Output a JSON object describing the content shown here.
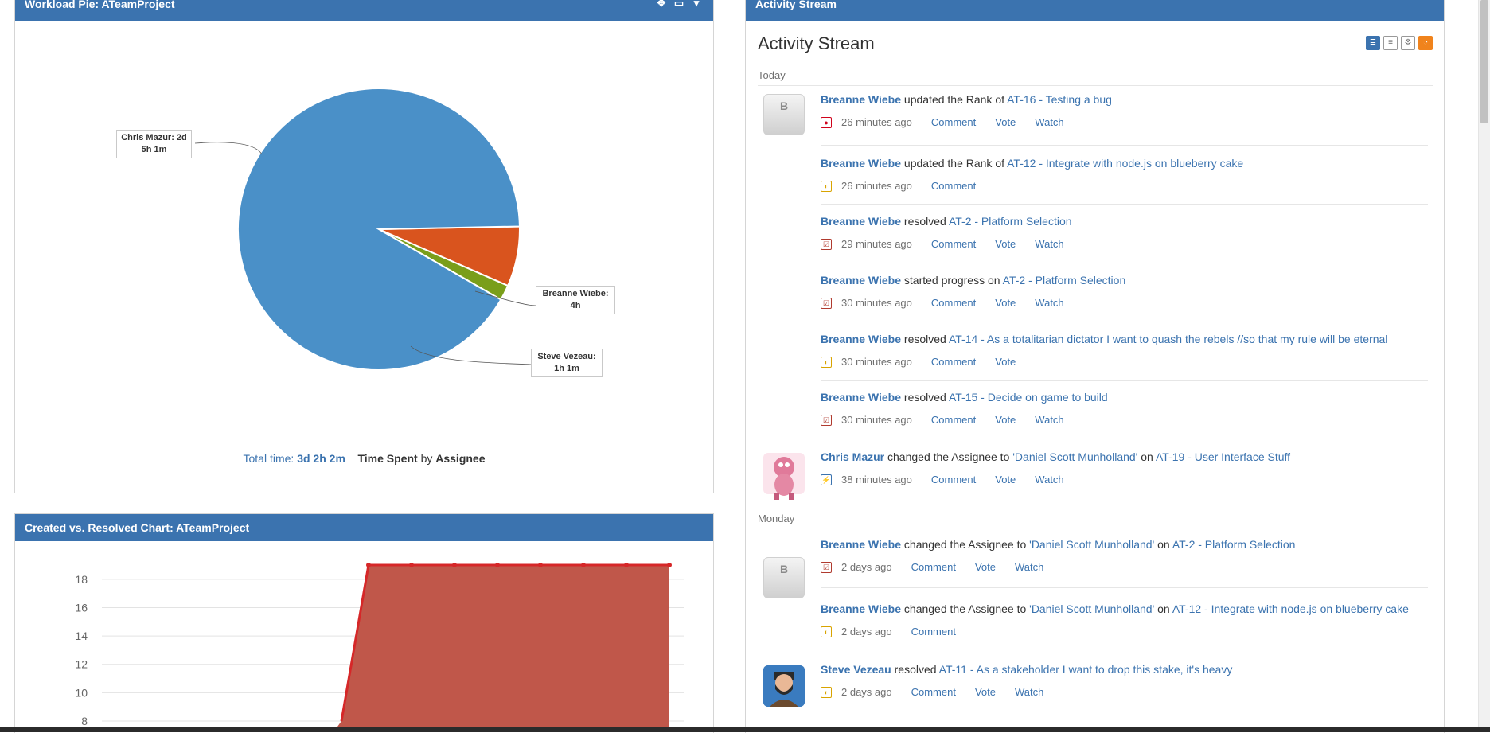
{
  "pie_gadget": {
    "title": "Workload Pie: ATeamProject",
    "tooltips": [
      {
        "text": "Chris Mazur: 2d 5h 1m",
        "line1": "Chris Mazur: 2d",
        "line2": "5h 1m"
      },
      {
        "text": "Breanne Wiebe: 4h",
        "line1": "Breanne Wiebe:",
        "line2": "4h"
      },
      {
        "text": "Steve Vezeau: 1h 1m",
        "line1": "Steve Vezeau:",
        "line2": "1h 1m"
      }
    ],
    "footer": {
      "total_label": "Total time:",
      "total_value": "3d 2h 2m",
      "field": "Time Spent",
      "by": "by",
      "group": "Assignee"
    }
  },
  "chart_data": [
    {
      "type": "pie",
      "labels": [
        "Chris Mazur",
        "Breanne Wiebe",
        "Steve Vezeau"
      ],
      "values": [
        53.0,
        4.0,
        1.0167
      ],
      "display_values": [
        "2d 5h 1m",
        "4h",
        "1h 1m"
      ],
      "colors": [
        "#4a90c8",
        "#d9541e",
        "#7a9e1a"
      ]
    },
    {
      "type": "area",
      "title": "Created vs. Resolved Chart: ATeamProject",
      "y_ticks": [
        8,
        10,
        12,
        14,
        16,
        18
      ],
      "series": [
        {
          "values": [
            8,
            19,
            19,
            19,
            19,
            19,
            19,
            19,
            19
          ]
        }
      ],
      "colors": {
        "line": "#d62728",
        "fill": "#c0574a"
      }
    }
  ],
  "created_gadget": {
    "title": "Created vs. Resolved Chart: ATeamProject"
  },
  "activity": {
    "gadget_title": "Activity Stream",
    "heading": "Activity Stream",
    "days": [
      "Today",
      "Monday"
    ],
    "items": [
      {
        "user": "Breanne Wiebe",
        "verb": " updated the Rank of ",
        "target": "AT-16 - Testing a bug",
        "time": "26 minutes ago",
        "actions": [
          "Comment",
          "Vote",
          "Watch"
        ]
      },
      {
        "user": "Breanne Wiebe",
        "verb": " updated the Rank of ",
        "target": "AT-12 - Integrate with node.js on blueberry cake",
        "time": "26 minutes ago",
        "actions": [
          "Comment"
        ]
      },
      {
        "user": "Breanne Wiebe",
        "verb": " resolved ",
        "target": "AT-2 - Platform Selection",
        "time": "29 minutes ago",
        "actions": [
          "Comment",
          "Vote",
          "Watch"
        ]
      },
      {
        "user": "Breanne Wiebe",
        "verb": " started progress on ",
        "target": "AT-2 - Platform Selection",
        "time": "30 minutes ago",
        "actions": [
          "Comment",
          "Vote",
          "Watch"
        ]
      },
      {
        "user": "Breanne Wiebe",
        "verb": " resolved ",
        "target": "AT-14 - As a totalitarian dictator I want to quash the rebels //so that my rule will be eternal",
        "time": "30 minutes ago",
        "actions": [
          "Comment",
          "Vote"
        ]
      },
      {
        "user": "Breanne Wiebe",
        "verb": " resolved ",
        "target": "AT-15 - Decide on game to build",
        "time": "30 minutes ago",
        "actions": [
          "Comment",
          "Vote",
          "Watch"
        ]
      },
      {
        "user": "Chris Mazur",
        "verb": " changed the Assignee to ",
        "assignee": "'Daniel Scott Munholland'",
        "on": " on ",
        "target": "AT-19 - User Interface Stuff",
        "time": "38 minutes ago",
        "actions": [
          "Comment",
          "Vote",
          "Watch"
        ]
      },
      {
        "user": "Breanne Wiebe",
        "verb": " changed the Assignee to ",
        "assignee": "'Daniel Scott Munholland'",
        "on": " on ",
        "target": "AT-2 - Platform Selection",
        "time": "2 days ago",
        "actions": [
          "Comment",
          "Vote",
          "Watch"
        ]
      },
      {
        "user": "Breanne Wiebe",
        "verb": " changed the Assignee to ",
        "assignee": "'Daniel Scott Munholland'",
        "on": " on ",
        "target": "AT-12 - Integrate with node.js on blueberry cake",
        "time": "2 days ago",
        "actions": [
          "Comment"
        ]
      },
      {
        "user": "Steve Vezeau",
        "verb": " resolved ",
        "target": "AT-11 - As a stakeholder I want to drop this stake, it's heavy",
        "time": "2 days ago",
        "actions": [
          "Comment",
          "Vote",
          "Watch"
        ]
      }
    ],
    "avatars": {
      "breanne_initial": "B"
    }
  }
}
